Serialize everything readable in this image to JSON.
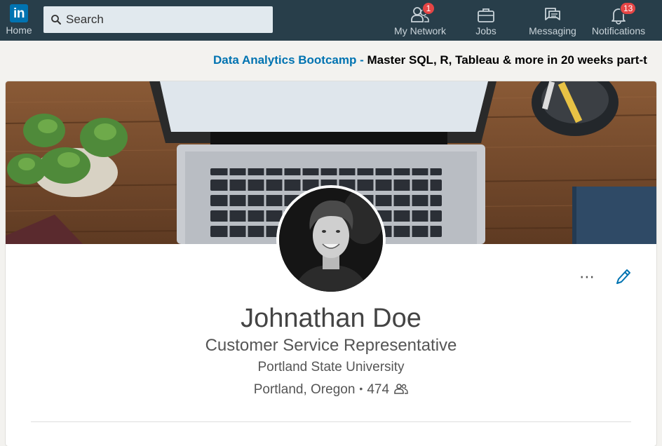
{
  "nav": {
    "logo_text": "in",
    "home_label": "Home",
    "search_placeholder": "Search",
    "items": [
      {
        "label": "My Network",
        "icon": "people-icon",
        "badge": "1"
      },
      {
        "label": "Jobs",
        "icon": "briefcase-icon",
        "badge": null
      },
      {
        "label": "Messaging",
        "icon": "chat-icon",
        "badge": null
      },
      {
        "label": "Notifications",
        "icon": "bell-icon",
        "badge": "13"
      }
    ]
  },
  "ad": {
    "link_text": "Data Analytics Bootcamp -",
    "text": " Master SQL, R, Tableau & more in 20 weeks part-t"
  },
  "profile": {
    "name": "Johnathan Doe",
    "headline": "Customer Service Representative",
    "school": "Portland State University",
    "location": "Portland, Oregon",
    "separator": "•",
    "connections": "474"
  },
  "colors": {
    "nav_bg": "#283e4a",
    "brand": "#0073b1",
    "badge": "#e54545"
  }
}
